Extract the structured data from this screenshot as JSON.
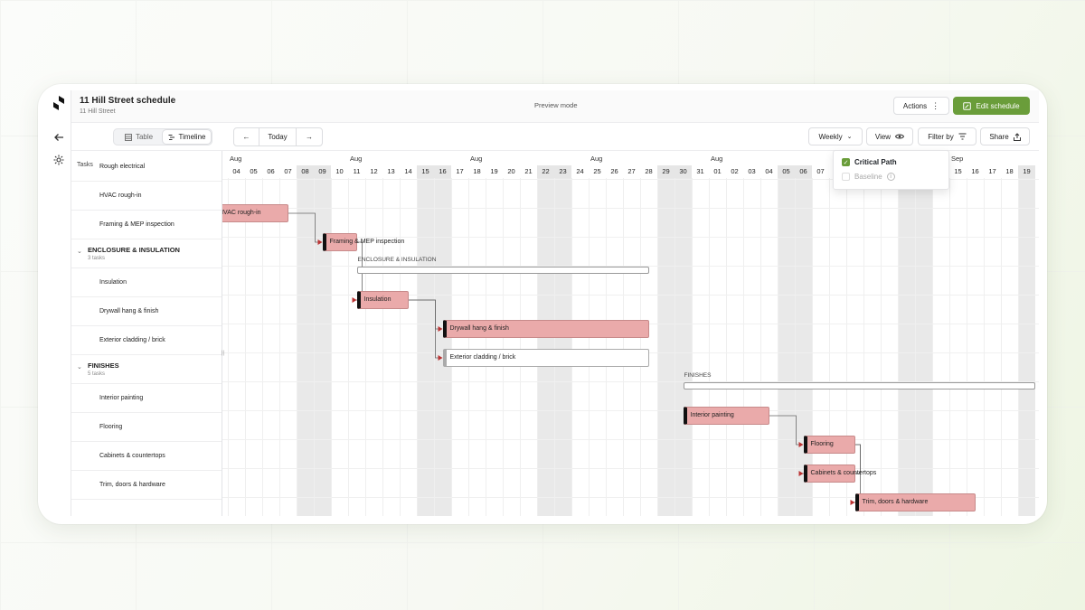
{
  "project": {
    "title": "11 Hill Street schedule",
    "subtitle": "11 Hill Street",
    "mode": "Preview mode"
  },
  "header": {
    "actions_label": "Actions",
    "edit_label": "Edit schedule"
  },
  "toolbar": {
    "view_table": "Table",
    "view_timeline": "Timeline",
    "today": "Today",
    "weekly": "Weekly",
    "view": "View",
    "filter": "Filter by",
    "share": "Share"
  },
  "list": {
    "header": "Tasks"
  },
  "tasks": [
    {
      "label": "Rough electrical",
      "type": "task"
    },
    {
      "label": "HVAC rough-in",
      "type": "task"
    },
    {
      "label": "Framing & MEP inspection",
      "type": "task"
    },
    {
      "label": "ENCLOSURE & INSULATION",
      "sub": "3 tasks",
      "type": "group"
    },
    {
      "label": "Insulation",
      "type": "task"
    },
    {
      "label": "Drywall hang & finish",
      "type": "task"
    },
    {
      "label": "Exterior cladding / brick",
      "type": "task"
    },
    {
      "label": "FINISHES",
      "sub": "5 tasks",
      "type": "group"
    },
    {
      "label": "Interior painting",
      "type": "task"
    },
    {
      "label": "Flooring",
      "type": "task"
    },
    {
      "label": "Cabinets & countertops",
      "type": "task"
    },
    {
      "label": "Trim, doors & hardware",
      "type": "task"
    }
  ],
  "timeline": {
    "months": [
      {
        "label": "Aug",
        "day": "04"
      },
      {
        "label": "Aug",
        "day": "11"
      },
      {
        "label": "Aug",
        "day": "18"
      },
      {
        "label": "Aug",
        "day": "25"
      },
      {
        "label": "Aug",
        "day": "01"
      },
      {
        "label": "Sep",
        "day": "15"
      }
    ],
    "days": [
      "3",
      "04",
      "05",
      "06",
      "07",
      "08",
      "09",
      "10",
      "11",
      "12",
      "13",
      "14",
      "15",
      "16",
      "17",
      "18",
      "19",
      "20",
      "21",
      "22",
      "23",
      "24",
      "25",
      "26",
      "27",
      "28",
      "29",
      "30",
      "31",
      "01",
      "02",
      "03",
      "04",
      "05",
      "06",
      "07",
      "08",
      "09",
      "10",
      "11",
      "12",
      "13",
      "14",
      "15",
      "16",
      "17",
      "18",
      "19"
    ],
    "weekend_indices": [
      5,
      6,
      12,
      13,
      19,
      20,
      26,
      27,
      33,
      34,
      40,
      41,
      47
    ]
  },
  "bars": [
    {
      "label": "HVAC rough-in",
      "row": 1,
      "start": 0,
      "end": 4.5,
      "style": "crit"
    },
    {
      "label": "Framing & MEP inspection",
      "row": 2,
      "start": 6.5,
      "end": 8.5,
      "style": "crit-cap"
    },
    {
      "label": "Insulation",
      "row": 4,
      "start": 8.5,
      "end": 11.5,
      "style": "crit-cap"
    },
    {
      "label": "Drywall hang & finish",
      "row": 5,
      "start": 13.5,
      "end": 25.5,
      "style": "crit-cap"
    },
    {
      "label": "Exterior cladding / brick",
      "row": 6,
      "start": 13.5,
      "end": 25.5,
      "style": "normal-cap"
    },
    {
      "label": "Interior painting",
      "row": 8,
      "start": 27.5,
      "end": 32.5,
      "style": "crit-cap"
    },
    {
      "label": "Flooring",
      "row": 9,
      "start": 34.5,
      "end": 37.5,
      "style": "crit-cap"
    },
    {
      "label": "Cabinets & countertops",
      "row": 10,
      "start": 34.5,
      "end": 37.5,
      "style": "crit-cap"
    },
    {
      "label": "Trim, doors & hardware",
      "row": 11,
      "start": 37.5,
      "end": 44.5,
      "style": "crit-cap"
    }
  ],
  "summaries": [
    {
      "label": "ENCLOSURE & INSULATION",
      "row": 3,
      "start": 8.5,
      "end": 25.5
    },
    {
      "label": "FINISHES",
      "row": 7,
      "start": 27.5,
      "end": 48
    }
  ],
  "links": [
    [
      0,
      1
    ],
    [
      1,
      2
    ],
    [
      2,
      3
    ],
    [
      2,
      4
    ],
    [
      5,
      6
    ],
    [
      6,
      7
    ],
    [
      6,
      8
    ]
  ],
  "view_menu": {
    "critical_path": "Critical Path",
    "baseline": "Baseline"
  },
  "colors": {
    "accent": "#6a9d3a",
    "critical": "#eaaaaa",
    "link": "#555555"
  }
}
